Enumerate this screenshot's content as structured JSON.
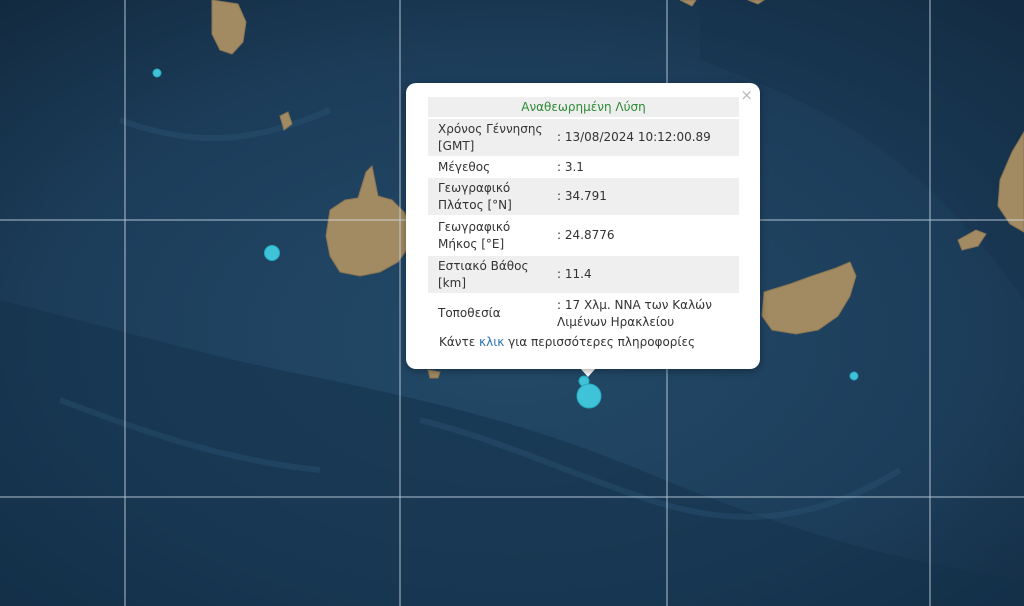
{
  "map": {
    "colors": {
      "sea": "#1b3c58",
      "land": "#a08a62",
      "grid": "#ffffff",
      "marker": "#3ec3d8"
    },
    "icons": [
      "earthquake-marker-icon",
      "close-icon"
    ]
  },
  "popup": {
    "close_label": "×",
    "title": "Αναθεωρημένη Λύση",
    "fields": [
      {
        "label": "Χρόνος Γέννησης [GMT]",
        "value": ": 13/08/2024 10:12:00.89"
      },
      {
        "label": "Μέγεθος",
        "value": ": 3.1"
      },
      {
        "label": "Γεωγραφικό Πλάτος [°N]",
        "value": ": 34.791"
      },
      {
        "label": "Γεωγραφικό Μήκος [°E]",
        "value": ": 24.8776"
      },
      {
        "label": "Εστιακό Βάθος [km]",
        "value": ": 11.4"
      },
      {
        "label": "Τοποθεσία",
        "value": ": 17 Χλμ. ΝΝΑ των Καλών Λιμένων Ηρακλείου"
      }
    ],
    "footer_pre": "Κάντε ",
    "footer_link": "κλικ",
    "footer_post": " για περισσότερες πληροφορίες"
  }
}
